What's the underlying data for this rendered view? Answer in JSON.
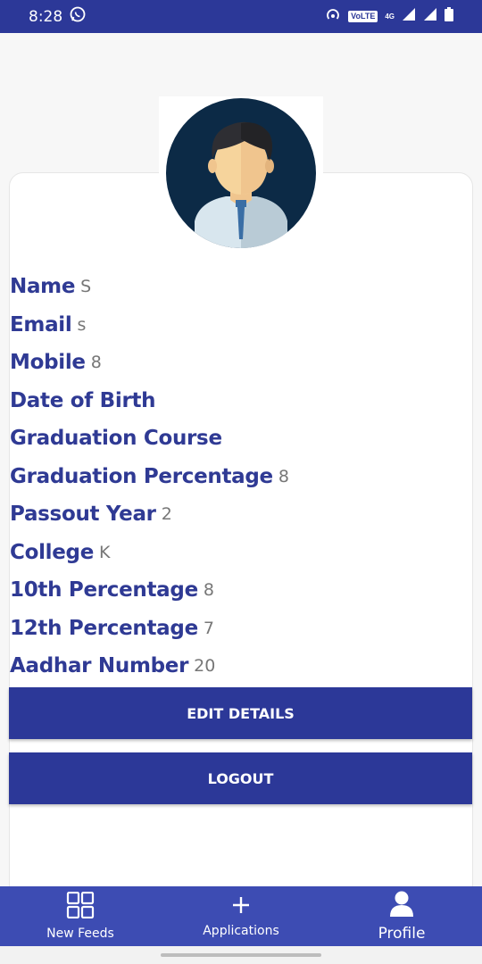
{
  "status_bar": {
    "time": "8:28",
    "volte_label": "VoLTE",
    "network_label": "4G"
  },
  "profile": {
    "fields": [
      {
        "label": "Name",
        "value": "S"
      },
      {
        "label": "Email",
        "value": "s"
      },
      {
        "label": "Mobile",
        "value": "8"
      },
      {
        "label": "Date of Birth",
        "value": ""
      },
      {
        "label": "Graduation Course",
        "value": ""
      },
      {
        "label": "Graduation Percentage",
        "value": "8"
      },
      {
        "label": "Passout Year",
        "value": "2"
      },
      {
        "label": "College",
        "value": "K"
      },
      {
        "label": "10th Percentage",
        "value": "8"
      },
      {
        "label": "12th Percentage",
        "value": "7"
      },
      {
        "label": "Aadhar Number",
        "value": "20"
      }
    ]
  },
  "buttons": {
    "edit": "EDIT DETAILS",
    "logout": "LOGOUT"
  },
  "bottom_nav": {
    "items": [
      {
        "label": "New Feeds",
        "icon": "grid-icon"
      },
      {
        "label": "Applications",
        "icon": "plus-icon"
      },
      {
        "label": "Profile",
        "icon": "person-icon"
      }
    ]
  },
  "colors": {
    "primary": "#2c3898",
    "label": "#2f3a94",
    "nav": "#3d4cb3"
  }
}
